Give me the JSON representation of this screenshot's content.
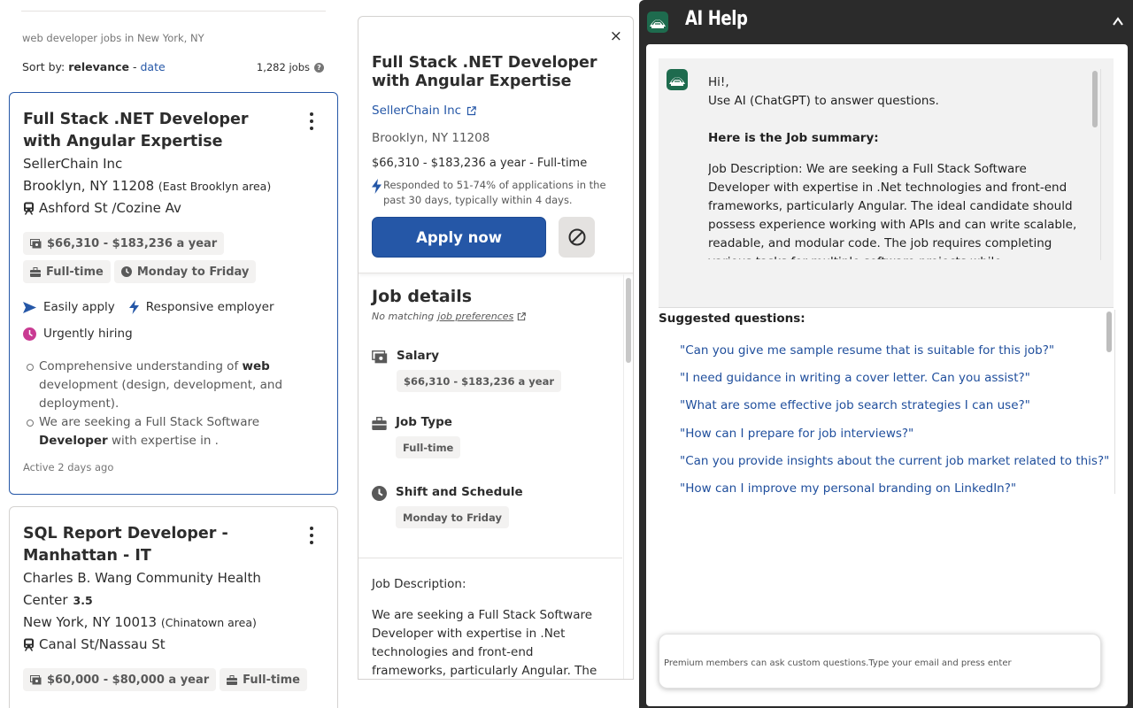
{
  "results": {
    "query": "web developer jobs in New York, NY",
    "sort_prefix": "Sort by: ",
    "sort_active": "relevance",
    "sort_sep": " - ",
    "sort_alt": "date",
    "count": "1,282 jobs",
    "cards": [
      {
        "title": "Full Stack .NET Developer with Angular Expertise",
        "company": "SellerChain Inc",
        "location": "Brooklyn, NY 11208",
        "area": "(East Brooklyn area)",
        "transit": "Ashford St /Cozine Av",
        "salary": "$66,310 - $183,236 a year",
        "job_type": "Full-time",
        "schedule": "Monday to Friday",
        "easily_apply": "Easily apply",
        "responsive": "Responsive employer",
        "urgent": "Urgently hiring",
        "snippet1_a": "Comprehensive understanding of ",
        "snippet1_b": "web",
        "snippet1_c": " development (design, development, and deployment).",
        "snippet2_a": "We are seeking a Full Stack Software ",
        "snippet2_b": "Developer",
        "snippet2_c": " with expertise in .",
        "active": "Active 2 days ago"
      },
      {
        "title": "SQL Report Developer - Manhattan - IT",
        "company": "Charles B. Wang Community Health Center",
        "rating": "3.5",
        "location": "New York, NY 10013",
        "area": "(Chinatown area)",
        "transit": "Canal St/Nassau St",
        "salary": "$60,000 - $80,000 a year",
        "job_type": "Full-time"
      }
    ]
  },
  "job_panel": {
    "close": "×",
    "title": "Full Stack .NET Developer with Angular Expertise",
    "company": "SellerChain Inc",
    "location": "Brooklyn, NY 11208",
    "salary_line": "$66,310 - $183,236 a year  - Full-time",
    "responded": "Responded to 51-74% of applications in the past 30 days, typically within 4 days.",
    "apply_label": "Apply now",
    "details_heading": "Job details",
    "prefs_prefix": "No matching ",
    "prefs_link": "job preferences",
    "salary_label": "Salary",
    "salary_value": "$66,310 - $183,236 a year",
    "jobtype_label": "Job Type",
    "jobtype_value": "Full-time",
    "schedule_label": "Shift and Schedule",
    "schedule_value": "Monday to Friday",
    "desc_heading": "Job Description:",
    "desc_text": "We are seeking a Full Stack Software Developer with expertise in .Net technologies and front-end frameworks, particularly Angular. The ideal candidate"
  },
  "ai_help": {
    "title": "AI Help",
    "greeting": "Hi!,",
    "intro": "Use AI (ChatGPT) to answer questions.",
    "summary_heading": "Here is the Job summary:",
    "summary_text": "Job Description: We are seeking a Full Stack Software Developer with expertise in .Net technologies and front-end frameworks, particularly Angular. The ideal candidate should possess experience working with APIs and can write scalable, readable, and modular code. The job requires completing various tasks for multiple software projects while accommodating the changing business needs and collaborating with",
    "suggested_heading": "Suggested questions:",
    "suggestions": [
      "\"Can you give me sample resume that is suitable for this job?\"",
      "\"I need guidance in writing a cover letter. Can you assist?\"",
      "\"What are some effective job search strategies I can use?\"",
      "\"How can I prepare for job interviews?\"",
      "\"Can you provide insights about the current job market related to this?\"",
      "\"How can I improve my personal branding on LinkedIn?\""
    ],
    "input_placeholder": "Premium members can ask custom questions.Type your email and press enter"
  },
  "colors": {
    "accent": "#2557a7",
    "ai_bg": "#2b2b2b",
    "logo_green": "#1e6b4e",
    "urgent": "#c93a92"
  }
}
